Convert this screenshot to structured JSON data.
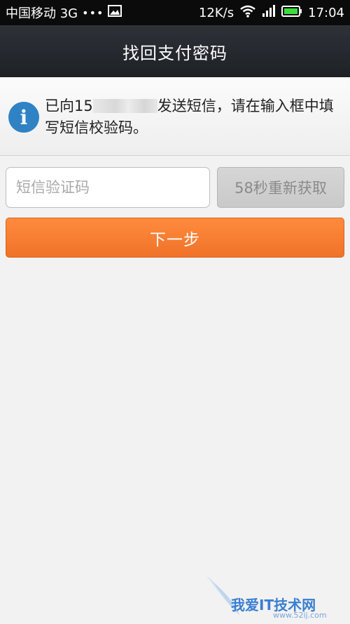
{
  "status_bar": {
    "carrier": "中国移动 3G",
    "dots": "•••",
    "speed": "12K/s",
    "time": "17:04",
    "icons": [
      "image-icon",
      "wifi-icon",
      "signal-icon",
      "battery-icon"
    ]
  },
  "header": {
    "title": "找回支付密码"
  },
  "notice": {
    "icon": "info-icon",
    "text_prefix": "已向15",
    "text_suffix": "发送短信，请在输入框中填写短信校验码。"
  },
  "form": {
    "code_placeholder": "短信验证码",
    "code_value": "",
    "resend_label": "58秒重新获取",
    "next_label": "下一步"
  },
  "watermark": {
    "text": "我爱IT技术网",
    "url": "www.52ij.com"
  },
  "colors": {
    "accent": "#ef7228",
    "header_bg": "#23272c",
    "info_blue": "#2f82c4"
  }
}
